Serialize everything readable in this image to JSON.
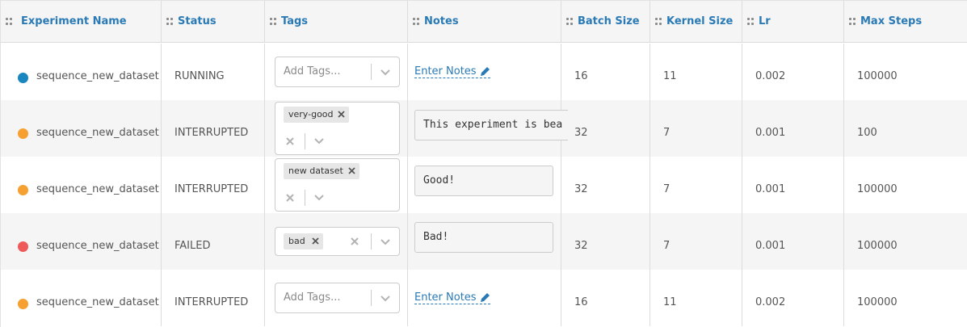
{
  "columns": [
    {
      "key": "name",
      "label": "Experiment Name"
    },
    {
      "key": "status",
      "label": "Status"
    },
    {
      "key": "tags",
      "label": "Tags"
    },
    {
      "key": "notes",
      "label": "Notes"
    },
    {
      "key": "batch_size",
      "label": "Batch Size"
    },
    {
      "key": "kernel_size",
      "label": "Kernel Size"
    },
    {
      "key": "lr",
      "label": "Lr"
    },
    {
      "key": "max_steps",
      "label": "Max Steps"
    }
  ],
  "tags_placeholder": "Add Tags...",
  "notes_placeholder": "Enter Notes",
  "status_colors": {
    "RUNNING": "#1a86c0",
    "INTERRUPTED": "#f5a030",
    "FAILED": "#ee5a5a"
  },
  "rows": [
    {
      "name": "sequence_new_dataset",
      "status": "RUNNING",
      "tags": [],
      "notes": "",
      "batch_size": "16",
      "kernel_size": "11",
      "lr": "0.002",
      "max_steps": "100000"
    },
    {
      "name": "sequence_new_dataset",
      "status": "INTERRUPTED",
      "tags": [
        "very-good"
      ],
      "notes": "This experiment is bea",
      "batch_size": "32",
      "kernel_size": "7",
      "lr": "0.001",
      "max_steps": "100"
    },
    {
      "name": "sequence_new_dataset",
      "status": "INTERRUPTED",
      "tags": [
        "new dataset"
      ],
      "notes": "Good!",
      "batch_size": "32",
      "kernel_size": "7",
      "lr": "0.001",
      "max_steps": "100000"
    },
    {
      "name": "sequence_new_dataset",
      "status": "FAILED",
      "tags": [
        "bad"
      ],
      "notes": "Bad!",
      "batch_size": "32",
      "kernel_size": "7",
      "lr": "0.001",
      "max_steps": "100000"
    },
    {
      "name": "sequence_new_dataset",
      "status": "INTERRUPTED",
      "tags": [],
      "notes": "",
      "batch_size": "16",
      "kernel_size": "11",
      "lr": "0.002",
      "max_steps": "100000"
    }
  ]
}
